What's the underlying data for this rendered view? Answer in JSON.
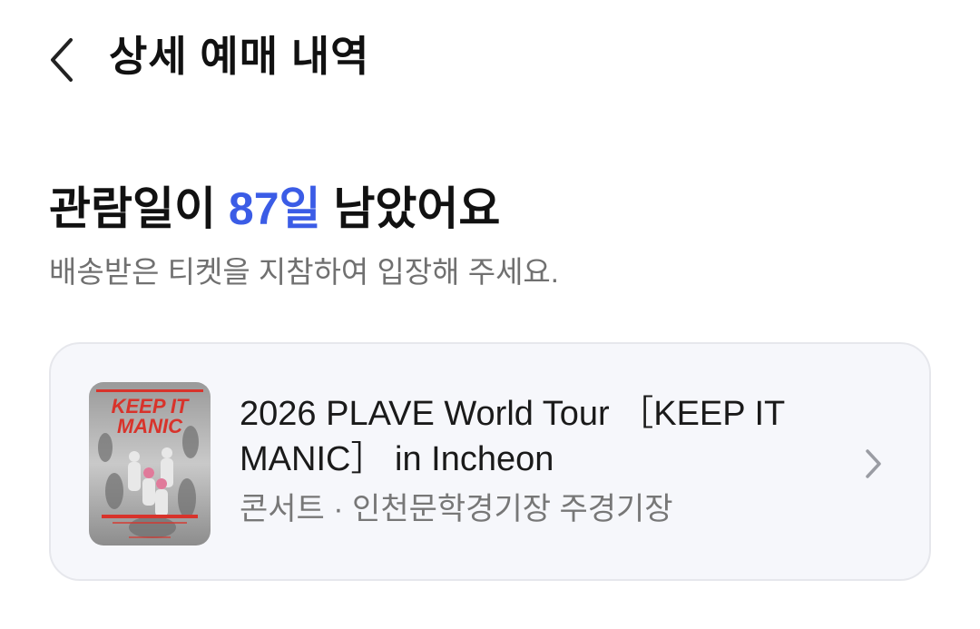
{
  "header": {
    "back_icon": "chevron-left-icon",
    "title": "상세 예매 내역"
  },
  "summary": {
    "prefix": "관람일이 ",
    "days": "87일",
    "suffix": " 남았어요",
    "instruction": "배송받은 티켓을 지참하여 입장해 주세요."
  },
  "event": {
    "title": "2026 PLAVE World Tour ［KEEP IT MANIC］ in Incheon",
    "meta": "콘서트 · 인천문학경기장 주경기장",
    "poster": {
      "headline_line1": "KEEP IT",
      "headline_line2": "MANIC"
    },
    "chevron_icon": "chevron-right-icon"
  },
  "colors": {
    "accent": "#3b5ce6",
    "card_bg": "#f6f7fb",
    "poster_red": "#d8332b",
    "muted_text": "#707070"
  }
}
